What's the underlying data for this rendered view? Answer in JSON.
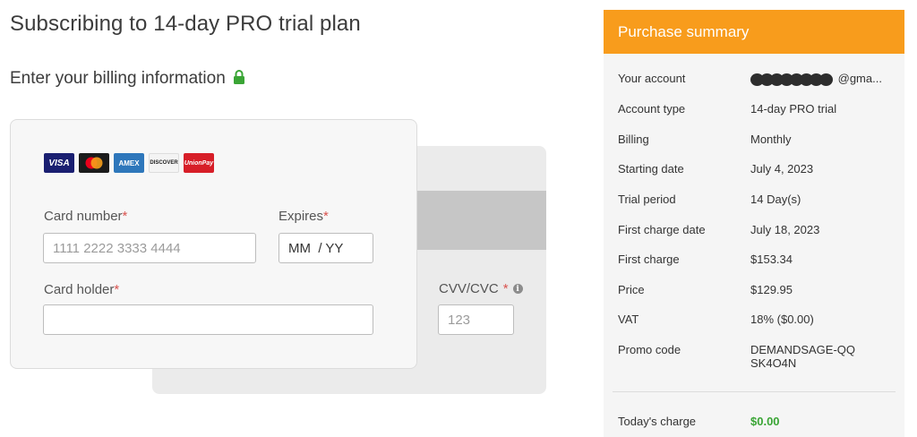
{
  "page": {
    "title": "Subscribing to 14-day PRO trial plan",
    "billing_heading": "Enter your billing information"
  },
  "icons": {
    "lock": "lock-icon",
    "info": "info-icon",
    "accent_color": "#f89c1c",
    "lock_color": "#3aa535",
    "required_color": "#d9534f",
    "positive_color": "#3aa535"
  },
  "card_form": {
    "card_logos": [
      "VISA",
      "mastercard",
      "AMEX",
      "DISCOVER",
      "UnionPay"
    ],
    "card_number": {
      "label": "Card number",
      "required_mark": "*",
      "placeholder": "1111 2222 3333 4444"
    },
    "expires": {
      "label": "Expires",
      "required_mark": "*",
      "value": "MM  / YY"
    },
    "card_holder": {
      "label": "Card holder",
      "required_mark": "*",
      "value": ""
    },
    "cvv": {
      "label": "CVV/CVC",
      "required_mark": "*",
      "placeholder": "123"
    }
  },
  "summary": {
    "header": "Purchase summary",
    "rows": [
      {
        "label": "Your account",
        "value": "@gma..."
      },
      {
        "label": "Account type",
        "value": "14-day PRO trial"
      },
      {
        "label": "Billing",
        "value": "Monthly"
      },
      {
        "label": "Starting date",
        "value": "July 4, 2023"
      },
      {
        "label": "Trial period",
        "value": "14 Day(s)"
      },
      {
        "label": "First charge date",
        "value": "July 18, 2023"
      },
      {
        "label": "First charge",
        "value": "$153.34"
      },
      {
        "label": "Price",
        "value": "$129.95"
      },
      {
        "label": "VAT",
        "value": "18% ($0.00)"
      },
      {
        "label": "Promo code",
        "value": "DEMANDSAGE-QQSK4O4N"
      }
    ],
    "today": {
      "label": "Today's charge",
      "value": "$0.00"
    }
  }
}
